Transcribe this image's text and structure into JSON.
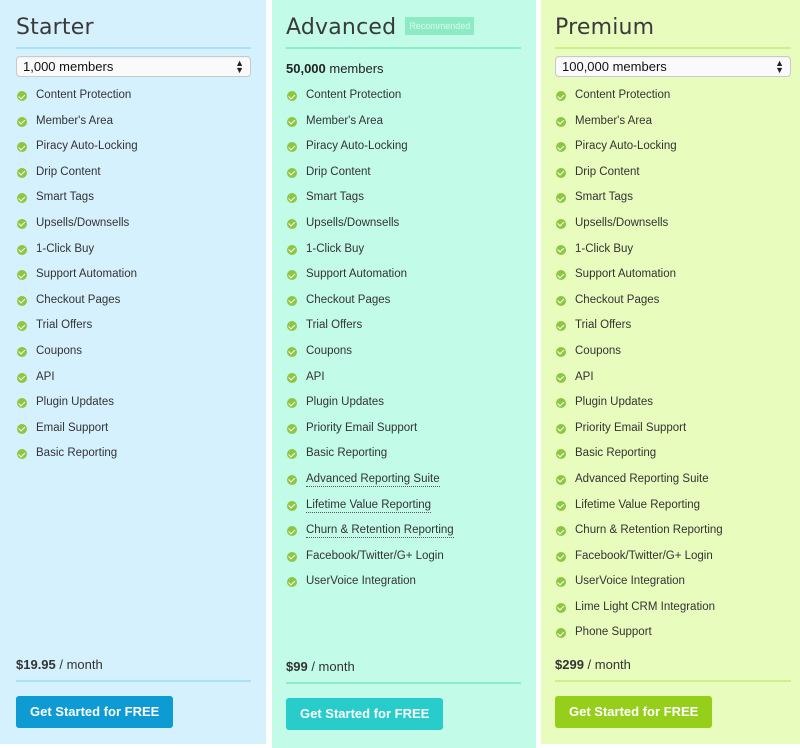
{
  "plans": {
    "starter": {
      "title": "Starter",
      "members_select": "1,000 members",
      "features": [
        "Content Protection",
        "Member's Area",
        "Piracy Auto-Locking",
        "Drip Content",
        "Smart Tags",
        "Upsells/Downsells",
        "1-Click Buy",
        "Support Automation",
        "Checkout Pages",
        "Trial Offers",
        "Coupons",
        "API",
        "Plugin Updates",
        "Email Support",
        "Basic Reporting"
      ],
      "price": "$19.95",
      "period": " / month",
      "cta": "Get Started for FREE",
      "accent": "#0e9ad3"
    },
    "advanced": {
      "title": "Advanced",
      "badge": "Recommended",
      "members_count": "50,000",
      "members_label": " members",
      "features": [
        "Content Protection",
        "Member's Area",
        "Piracy Auto-Locking",
        "Drip Content",
        "Smart Tags",
        "Upsells/Downsells",
        "1-Click Buy",
        "Support Automation",
        "Checkout Pages",
        "Trial Offers",
        "Coupons",
        "API",
        "Plugin Updates",
        "Priority Email Support",
        "Basic Reporting",
        "Advanced Reporting Suite",
        "Lifetime Value Reporting",
        "Churn & Retention Reporting",
        "Facebook/Twitter/G+ Login",
        "UserVoice Integration"
      ],
      "highlighted_features": [
        "Advanced Reporting Suite",
        "Lifetime Value Reporting",
        "Churn & Retention Reporting"
      ],
      "price": "$99",
      "period": " / month",
      "cta": "Get Started for FREE",
      "accent": "#27cccb"
    },
    "premium": {
      "title": "Premium",
      "members_select": "100,000 members",
      "features": [
        "Content Protection",
        "Member's Area",
        "Piracy Auto-Locking",
        "Drip Content",
        "Smart Tags",
        "Upsells/Downsells",
        "1-Click Buy",
        "Support Automation",
        "Checkout Pages",
        "Trial Offers",
        "Coupons",
        "API",
        "Plugin Updates",
        "Priority Email Support",
        "Basic Reporting",
        "Advanced Reporting Suite",
        "Lifetime Value Reporting",
        "Churn & Retention Reporting",
        "Facebook/Twitter/G+ Login",
        "UserVoice Integration",
        "Lime Light CRM Integration",
        "Phone Support"
      ],
      "price": "$299",
      "period": " / month",
      "cta": "Get Started for FREE",
      "accent": "#95cf1c"
    }
  },
  "icons": {
    "feature": "check-circle-icon",
    "select": "up-down-arrows-icon"
  }
}
